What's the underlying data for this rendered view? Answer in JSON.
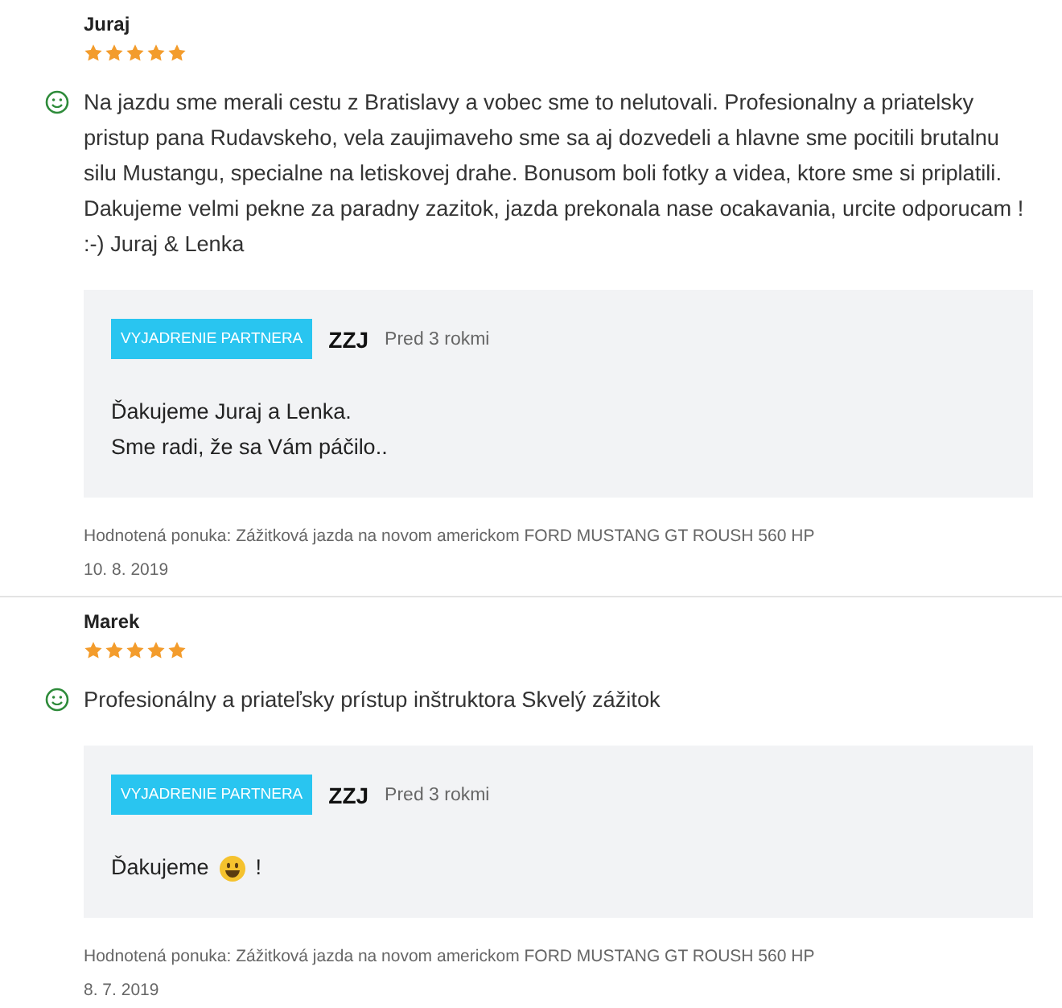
{
  "reviews": [
    {
      "author": "Juraj",
      "stars": 5,
      "text": "Na jazdu sme merali cestu z Bratislavy a vobec sme to nelutovali. Profesionalny a priatelsky pristup pana Rudavskeho, vela zaujimaveho sme sa aj dozvedeli a hlavne sme pocitili brutalnu silu Mustangu, specialne na letiskovej drahe. Bonusom boli fotky a videa, ktore sme si priplatili. Dakujeme velmi pekne za paradny zazitok, jazda prekonala nase ocakavania, urcite odporucam ! :-) Juraj & Lenka",
      "reply": {
        "badge": "VYJADRENIE PARTNERA",
        "partner": "ZZJ",
        "time": "Pred 3 rokmi",
        "lines": [
          [
            {
              "kind": "text",
              "text": "Ďakujeme Juraj a Lenka."
            }
          ],
          [
            {
              "kind": "text",
              "text": "Sme radi, že sa Vám páčilo.."
            }
          ]
        ]
      },
      "offer": "Hodnotená ponuka: Zážitková jazda na novom americkom FORD MUSTANG GT ROUSH 560 HP",
      "date": "10. 8. 2019"
    },
    {
      "author": "Marek",
      "stars": 5,
      "text": "Profesionálny a priateľsky prístup inštruktora Skvelý zážitok",
      "reply": {
        "badge": "VYJADRENIE PARTNERA",
        "partner": "ZZJ",
        "time": "Pred 3 rokmi",
        "lines": [
          [
            {
              "kind": "text",
              "text": "Ďakujeme"
            },
            {
              "kind": "emoji"
            },
            {
              "kind": "text",
              "text": "!"
            }
          ]
        ]
      },
      "offer": "Hodnotená ponuka: Zážitková jazda na novom americkom FORD MUSTANG GT ROUSH 560 HP",
      "date": "8. 7. 2019"
    }
  ]
}
